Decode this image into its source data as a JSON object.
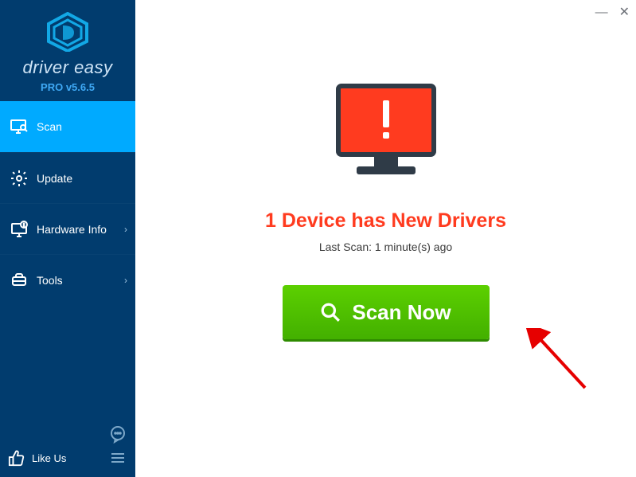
{
  "brand": {
    "title": "driver easy",
    "version": "PRO v5.6.5"
  },
  "nav": {
    "scan": "Scan",
    "update": "Update",
    "hardware": "Hardware Info",
    "tools": "Tools"
  },
  "bottom": {
    "like": "Like Us"
  },
  "main": {
    "headline": "1 Device has New Drivers",
    "subline": "Last Scan: 1 minute(s) ago",
    "scan_button": "Scan Now"
  },
  "winctrl": {
    "min": "—",
    "close": "✕"
  }
}
